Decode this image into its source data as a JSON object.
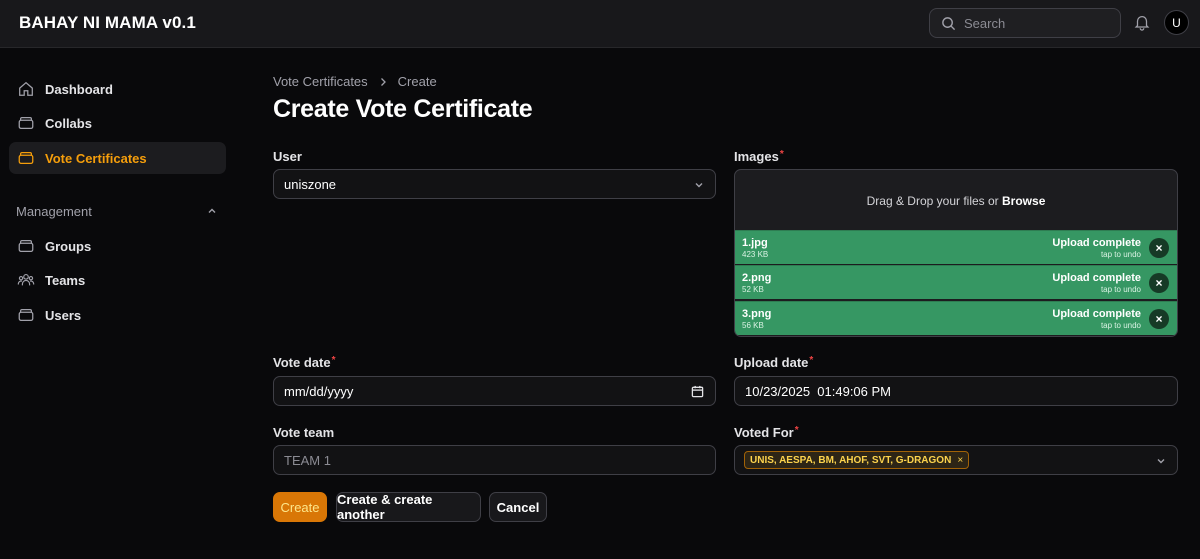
{
  "app": {
    "title": "BAHAY NI MAMA v0.1"
  },
  "header": {
    "search_placeholder": "Search",
    "avatar_initial": "U"
  },
  "sidebar": {
    "items": [
      {
        "label": "Dashboard",
        "icon": "home-icon",
        "active": false
      },
      {
        "label": "Collabs",
        "icon": "box-icon",
        "active": false
      },
      {
        "label": "Vote Certificates",
        "icon": "box-icon",
        "active": true
      }
    ],
    "group": {
      "label": "Management",
      "items": [
        {
          "label": "Groups",
          "icon": "box-icon"
        },
        {
          "label": "Teams",
          "icon": "users-icon"
        },
        {
          "label": "Users",
          "icon": "box-icon"
        }
      ]
    }
  },
  "breadcrumb": {
    "parent": "Vote Certificates",
    "current": "Create"
  },
  "page": {
    "title": "Create Vote Certificate"
  },
  "form": {
    "user": {
      "label": "User",
      "value": "uniszone"
    },
    "images": {
      "label": "Images",
      "drop_text": "Drag & Drop your files or",
      "browse": "Browse",
      "files": [
        {
          "name": "1.jpg",
          "size": "423 KB",
          "status": "Upload complete",
          "undo": "tap to undo"
        },
        {
          "name": "2.png",
          "size": "52 KB",
          "status": "Upload complete",
          "undo": "tap to undo"
        },
        {
          "name": "3.png",
          "size": "56 KB",
          "status": "Upload complete",
          "undo": "tap to undo"
        }
      ]
    },
    "vote_date": {
      "label": "Vote date",
      "value": "mm/dd/yyyy"
    },
    "upload_date": {
      "label": "Upload date",
      "value": "10/23/2025  01:49:06 PM"
    },
    "vote_team": {
      "label": "Vote team",
      "placeholder": "TEAM 1"
    },
    "voted_for": {
      "label": "Voted For",
      "tag": "UNIS, AESPA, BM, AHOF, SVT, G-DRAGON",
      "tag_remove": "×"
    }
  },
  "actions": {
    "create": "Create",
    "create_another": "Create & create another",
    "cancel": "Cancel"
  },
  "colors": {
    "accent": "#f59e0b",
    "primary_button": "#d97706",
    "upload_success": "#369763",
    "required": "#ef4444"
  }
}
